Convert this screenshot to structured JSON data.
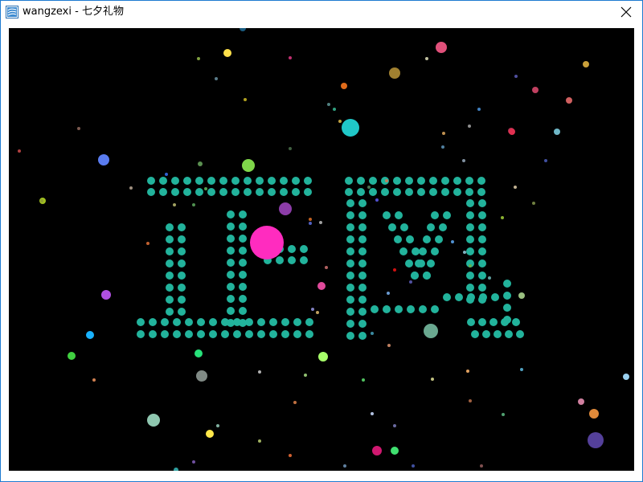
{
  "window": {
    "title": "wangzexi - 七夕礼物",
    "app_icon": "app-icon",
    "close_icon": "close-icon"
  },
  "colors": {
    "frame_border": "#1e7bd0",
    "canvas_bg": "#000000",
    "text_dot": "#22b39c"
  },
  "particles": [
    [
      "#e0507a",
      7
    ],
    [
      "#caa03a",
      4
    ],
    [
      "#a08030",
      7
    ],
    [
      "#e06b1a",
      4
    ],
    [
      "#c04060",
      4
    ],
    [
      "#d06060",
      4
    ],
    [
      "#20c8c8",
      11
    ],
    [
      "#6fb7c7",
      4
    ],
    [
      "#b03050",
      4
    ],
    [
      "#ff2cbf",
      21
    ],
    [
      "#8c3ca8",
      8
    ],
    [
      "#5a7cf0",
      7
    ],
    [
      "#7fd64a",
      8
    ],
    [
      "#ffe04a",
      5
    ],
    [
      "#e04a9b",
      5
    ],
    [
      "#b050e0",
      6
    ],
    [
      "#19b2ff",
      5
    ],
    [
      "#40d040",
      5
    ],
    [
      "#6aa890",
      9
    ],
    [
      "#a7ff6a",
      6
    ],
    [
      "#808a85",
      7
    ],
    [
      "#27e27a",
      5
    ],
    [
      "#8fc7b0",
      8
    ],
    [
      "#ffe84a",
      5
    ],
    [
      "#d01870",
      6
    ],
    [
      "#40e070",
      5
    ],
    [
      "#e08a3a",
      6
    ],
    [
      "#54409a",
      10
    ],
    [
      "#9ad0f0",
      4
    ],
    [
      "#d080a0",
      4
    ],
    [
      "#1a5c80",
      4
    ],
    [
      "#e03050",
      4
    ],
    [
      "#a0c020",
      4
    ],
    [
      "#5a9050",
      3
    ],
    [
      "#9ac080",
      4
    ],
    [
      "#30a0a0",
      3
    ]
  ]
}
